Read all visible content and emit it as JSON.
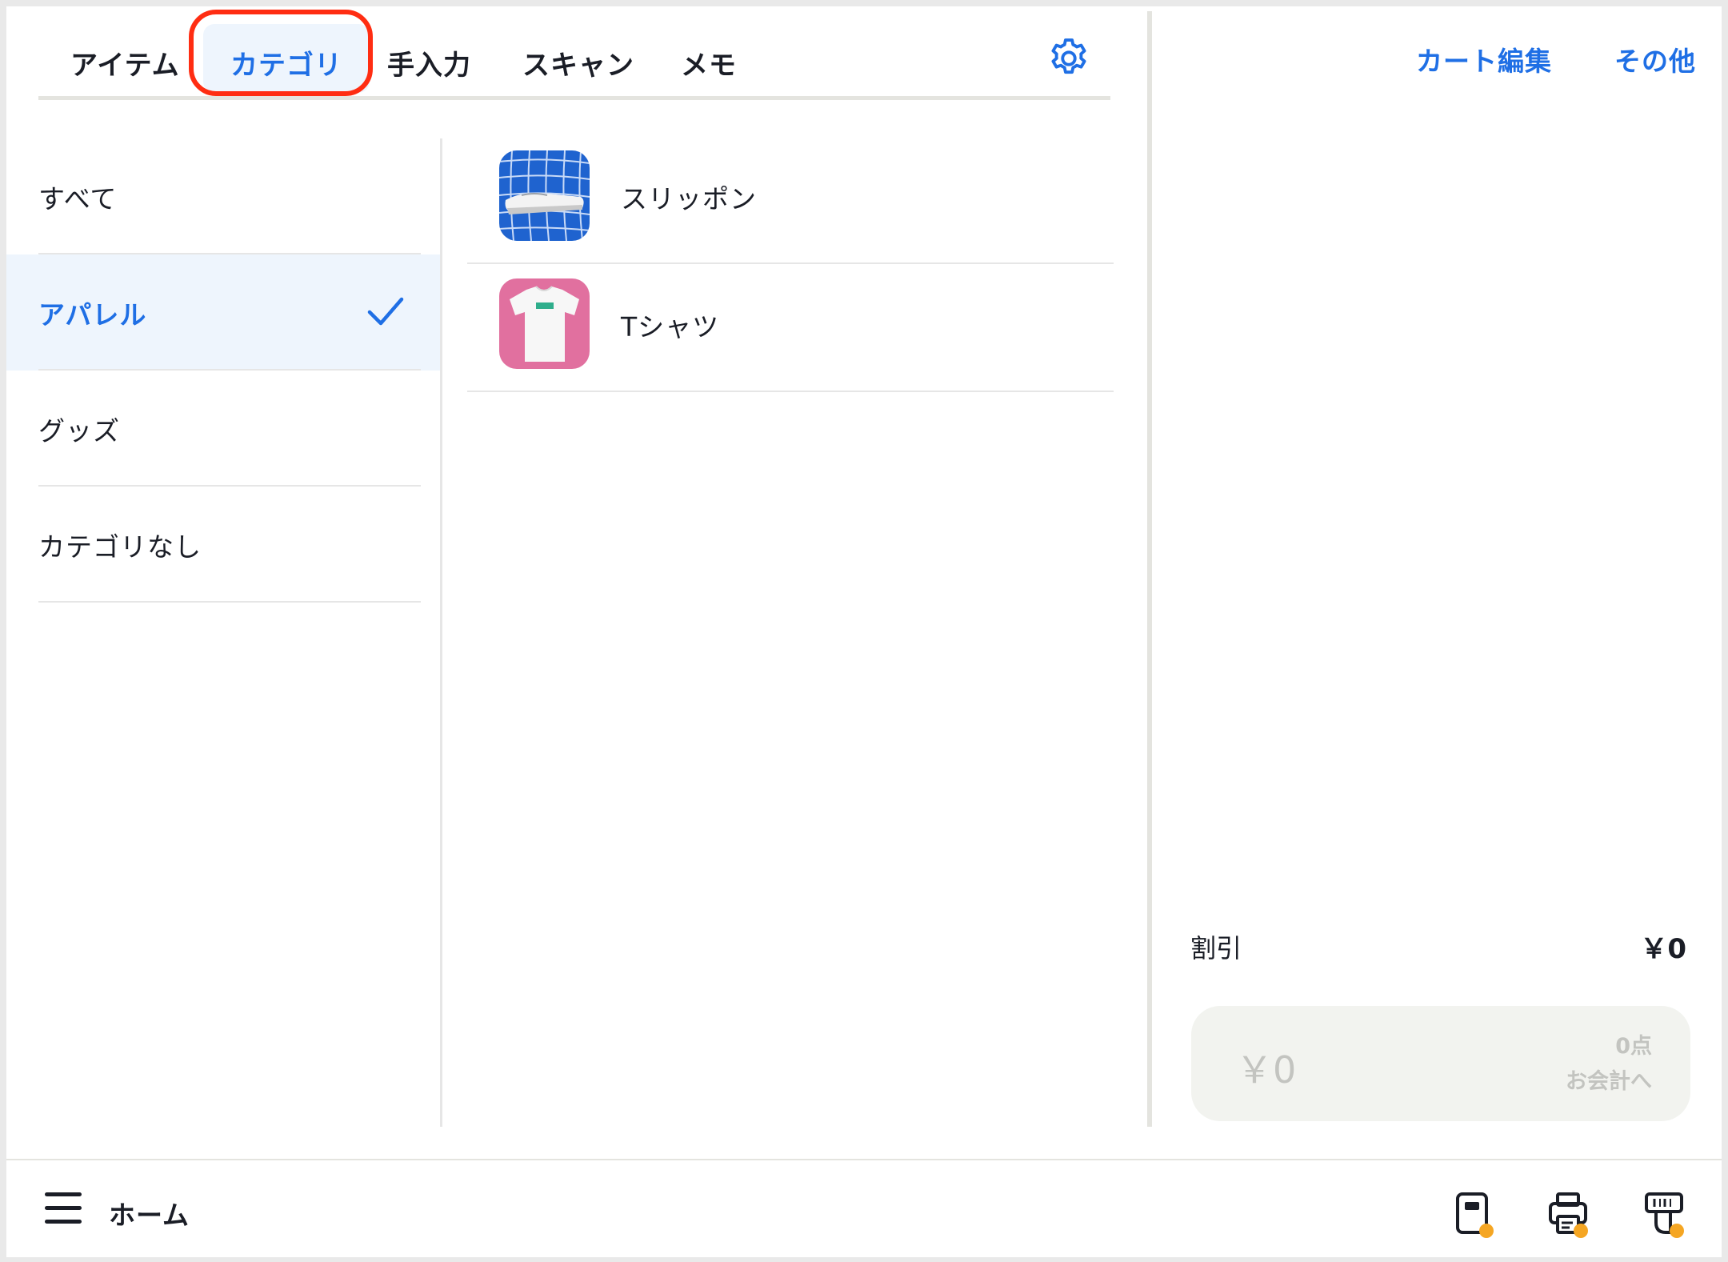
{
  "tabs": [
    {
      "label": "アイテム",
      "active": false
    },
    {
      "label": "カテゴリ",
      "active": true
    },
    {
      "label": "手入力",
      "active": false
    },
    {
      "label": "スキャン",
      "active": false
    },
    {
      "label": "メモ",
      "active": false
    }
  ],
  "settings_icon": "gear-icon",
  "categories": [
    {
      "label": "すべて",
      "selected": false
    },
    {
      "label": "アパレル",
      "selected": true
    },
    {
      "label": "グッズ",
      "selected": false
    },
    {
      "label": "カテゴリなし",
      "selected": false
    }
  ],
  "items": [
    {
      "name": "スリッポン",
      "thumb_bg": "#1f63cf"
    },
    {
      "name": "Tシャツ",
      "thumb_bg": "#e1709f"
    }
  ],
  "cart": {
    "edit_label": "カート編集",
    "more_label": "その他",
    "discount_label": "割引",
    "discount_value": "￥0",
    "total": "￥0",
    "count": "0点",
    "checkout_label": "お会計へ"
  },
  "bottom": {
    "home_label": "ホーム",
    "device_icons": [
      "card-reader-icon",
      "receipt-printer-icon",
      "barcode-scanner-icon"
    ],
    "status_dot_color": "#f5a623"
  },
  "colors": {
    "accent": "#1f6fe5",
    "highlight": "#ff2d12",
    "selected_bg": "#eef5fd"
  }
}
